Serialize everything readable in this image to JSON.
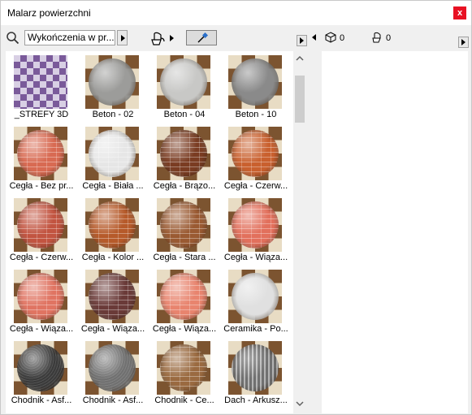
{
  "window": {
    "title": "Malarz powierzchni",
    "close_label": "x"
  },
  "search": {
    "value": "Wykończenia w pr..."
  },
  "right_toolbar": {
    "cube_count": "0",
    "bucket_count": "0"
  },
  "icons": {
    "search": "search-icon",
    "bucket": "paint-bucket-icon",
    "eyedropper": "eyedropper-icon",
    "cube": "cube-icon",
    "small_bucket": "paint-bucket-icon"
  },
  "materials": [
    {
      "label": "_STREFY 3D",
      "kind": "zone"
    },
    {
      "label": "Beton - 02",
      "kind": "concrete",
      "color": "#9c9c9a"
    },
    {
      "label": "Beton - 04",
      "kind": "concrete",
      "color": "#c8c8c6"
    },
    {
      "label": "Beton - 10",
      "kind": "concrete",
      "color": "#8a8a8a"
    },
    {
      "label": "Cegła - Bez pr...",
      "kind": "brick",
      "color": "#d86a52"
    },
    {
      "label": "Cegła - Biała ...",
      "kind": "brick",
      "color": "#e6e6e6"
    },
    {
      "label": "Cegła - Brązo...",
      "kind": "brick",
      "color": "#7a3c22"
    },
    {
      "label": "Cegła - Czerw...",
      "kind": "brick",
      "color": "#c9602e"
    },
    {
      "label": "Cegła - Czerw...",
      "kind": "brick",
      "color": "#c25440"
    },
    {
      "label": "Cegła - Kolor ...",
      "kind": "brick",
      "color": "#b65a2a"
    },
    {
      "label": "Cegła - Stara ...",
      "kind": "brick",
      "color": "#9a5a32"
    },
    {
      "label": "Cegła - Wiąza...",
      "kind": "brick",
      "color": "#e2705c"
    },
    {
      "label": "Cegła - Wiąza...",
      "kind": "brick",
      "color": "#e07462"
    },
    {
      "label": "Cegła - Wiąza...",
      "kind": "brick",
      "color": "#6a3a38"
    },
    {
      "label": "Cegła - Wiąza...",
      "kind": "brick",
      "color": "#e8846e"
    },
    {
      "label": "Ceramika - Po...",
      "kind": "ceramic",
      "color": "#e0e0e0"
    },
    {
      "label": "Chodnik - Asf...",
      "kind": "asphalt",
      "color": "#3a3a3a"
    },
    {
      "label": "Chodnik - Asf...",
      "kind": "asphalt",
      "color": "#707070"
    },
    {
      "label": "Chodnik - Ce...",
      "kind": "brick",
      "color": "#9a6a40"
    },
    {
      "label": "Dach - Arkusz...",
      "kind": "metal",
      "color": "#8c8c8c"
    }
  ]
}
